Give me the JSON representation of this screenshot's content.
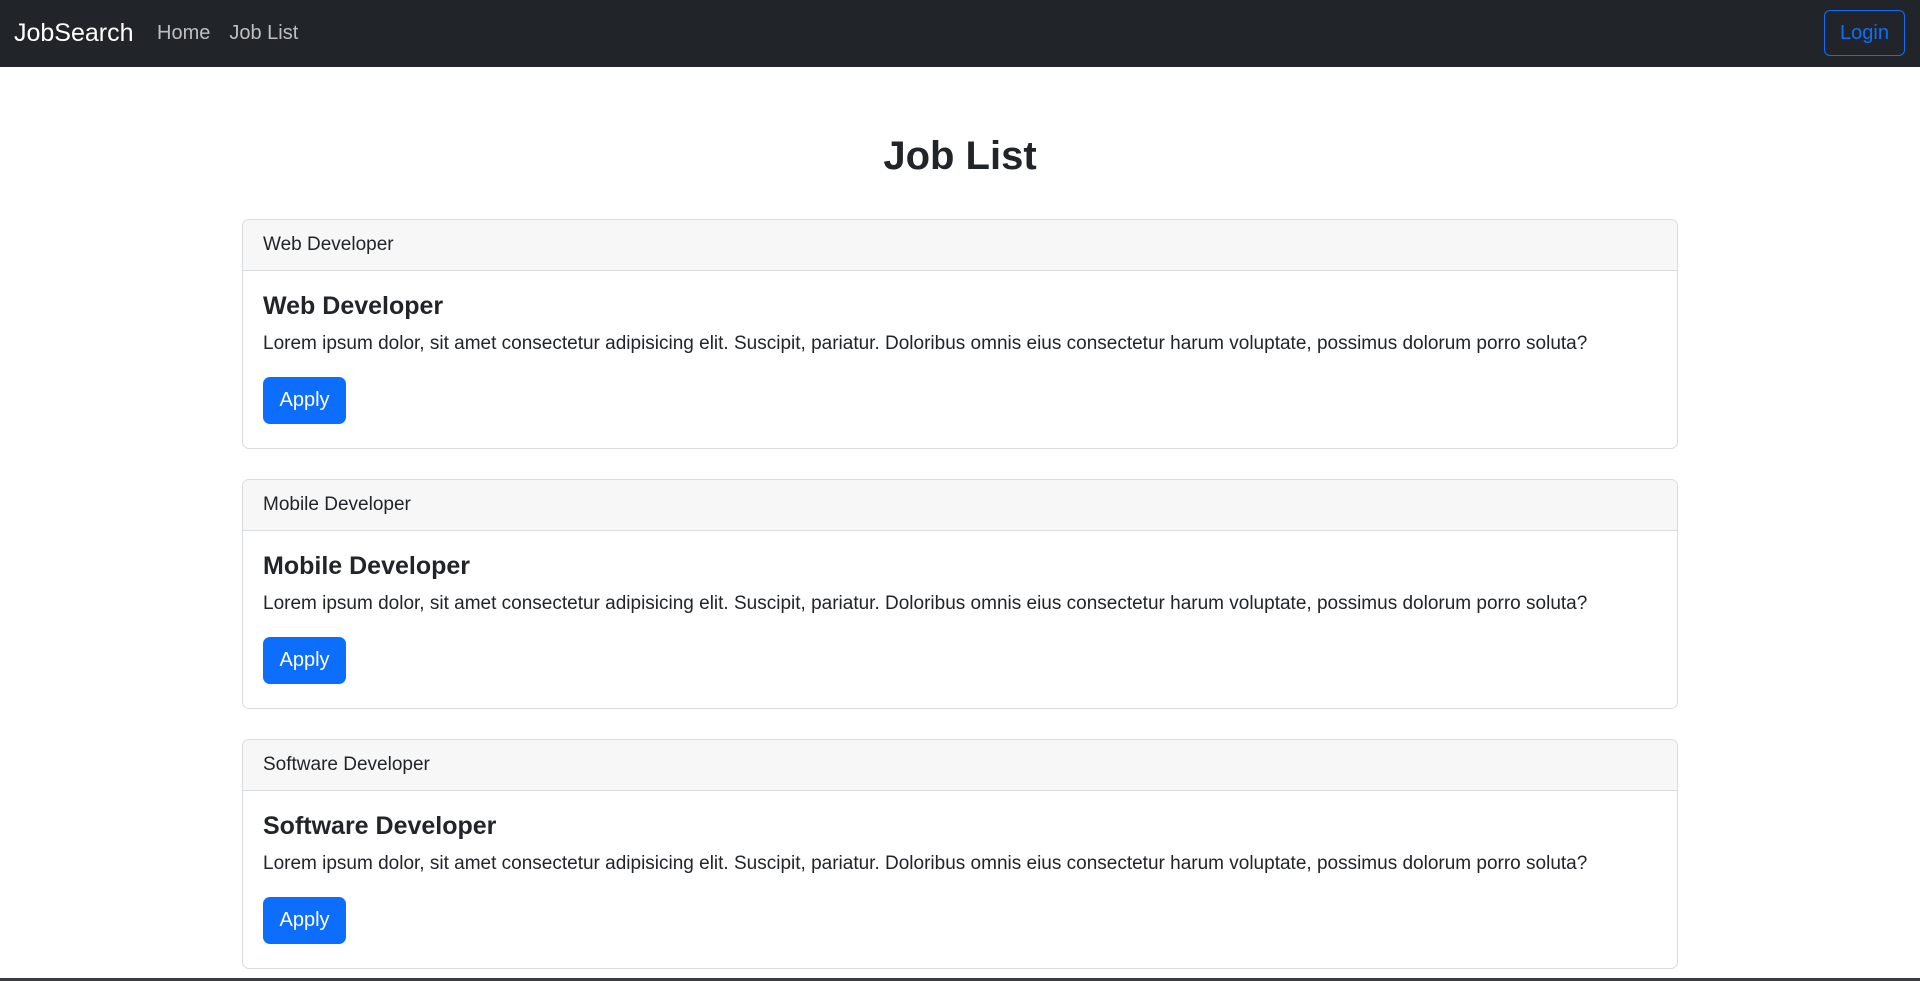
{
  "navbar": {
    "brand": "JobSearch",
    "links": [
      "Home",
      "Job List"
    ],
    "login_label": "Login"
  },
  "main": {
    "title": "Job List",
    "jobs": [
      {
        "header": "Web Developer",
        "title": "Web Developer",
        "description": "Lorem ipsum dolor, sit amet consectetur adipisicing elit. Suscipit, pariatur. Doloribus omnis eius consectetur harum voluptate, possimus dolorum porro soluta?",
        "button": "Apply"
      },
      {
        "header": "Mobile Developer",
        "title": "Mobile Developer",
        "description": "Lorem ipsum dolor, sit amet consectetur adipisicing elit. Suscipit, pariatur. Doloribus omnis eius consectetur harum voluptate, possimus dolorum porro soluta?",
        "button": "Apply"
      },
      {
        "header": "Software Developer",
        "title": "Software Developer",
        "description": "Lorem ipsum dolor, sit amet consectetur adipisicing elit. Suscipit, pariatur. Doloribus omnis eius consectetur harum voluptate, possimus dolorum porro soluta?",
        "button": "Apply"
      }
    ]
  },
  "colors": {
    "navbar_bg": "#212529",
    "primary": "#0d6efd",
    "card_header_bg": "#f7f7f7"
  }
}
